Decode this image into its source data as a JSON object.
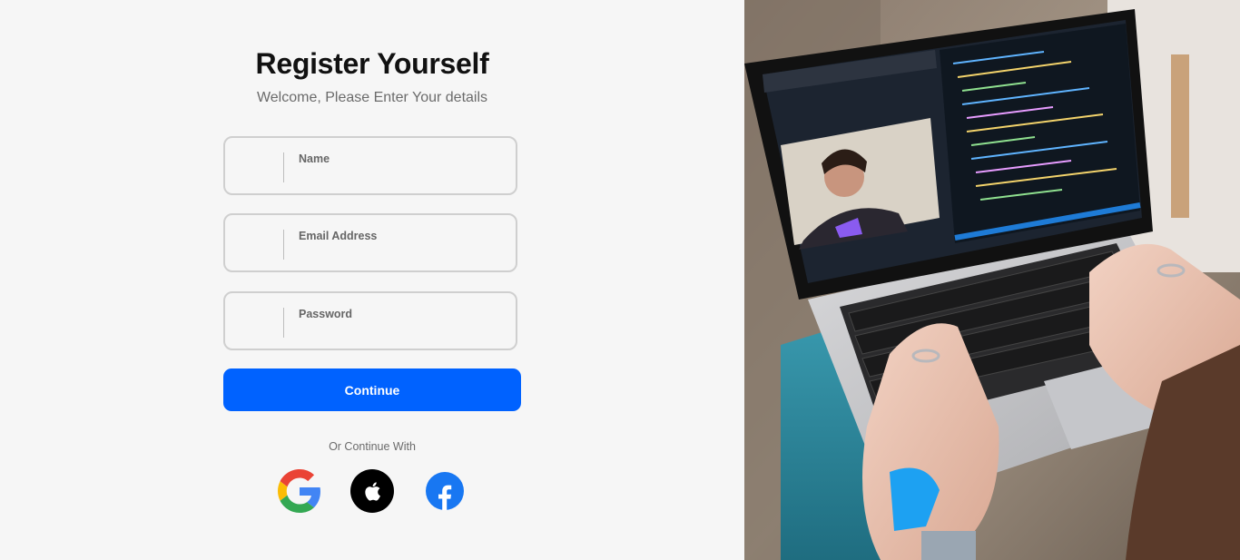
{
  "form": {
    "title": "Register Yourself",
    "subtitle": "Welcome, Please Enter Your details",
    "fields": [
      {
        "label": "Name",
        "value": ""
      },
      {
        "label": "Email Address",
        "value": ""
      },
      {
        "label": "Password",
        "value": ""
      }
    ],
    "continue_label": "Continue",
    "or_text": "Or Continue With",
    "social": [
      {
        "icon": "google-icon"
      },
      {
        "icon": "apple-icon"
      },
      {
        "icon": "facebook-icon"
      }
    ]
  },
  "colors": {
    "primary": "#0062ff",
    "background": "#f6f6f6",
    "facebook": "#1877f2",
    "apple": "#000000"
  }
}
